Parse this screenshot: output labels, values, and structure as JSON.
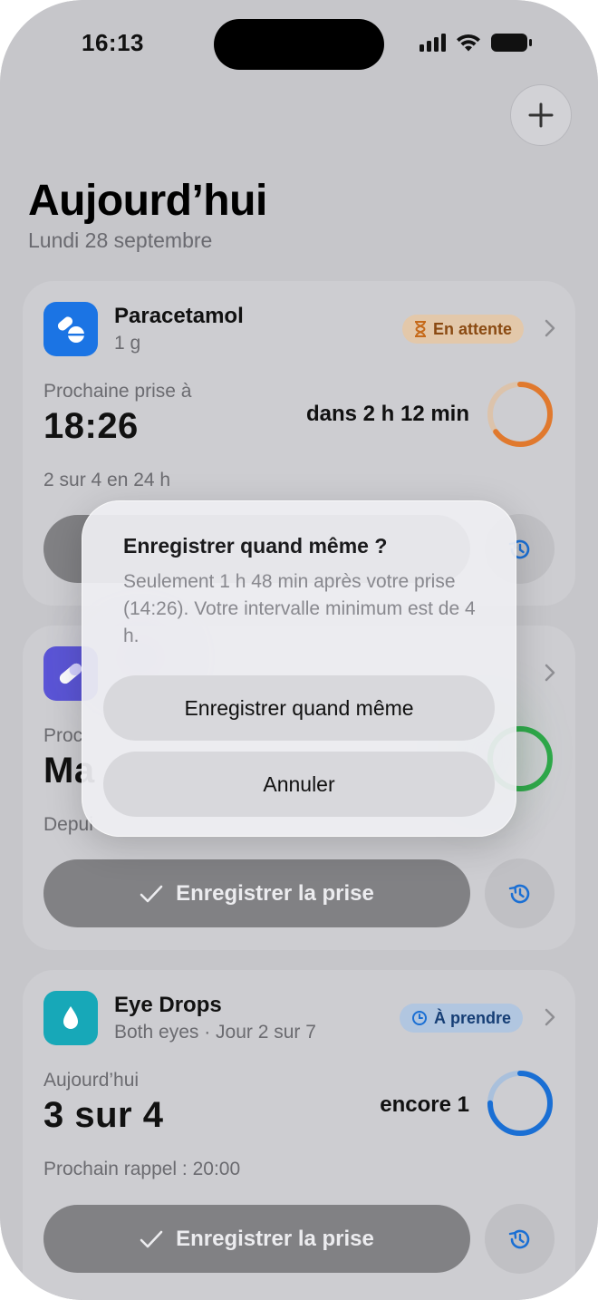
{
  "status_bar": {
    "time": "16:13"
  },
  "header": {
    "title": "Aujourd’hui",
    "date": "Lundi 28 septembre"
  },
  "cards": [
    {
      "name": "Paracetamol",
      "dose": "1 g",
      "status": "En attente",
      "label": "Prochaine prise à",
      "value": "18:26",
      "countdown": "dans 2 h 12 min",
      "footer": "2 sur 4 en 24 h",
      "ring_progress": 0.65,
      "accent": "#e0792e"
    },
    {
      "label_partial": "Proc",
      "value_partial": "Ma",
      "footer_partial": "Depui",
      "log_button": "Enregistrer la prise",
      "accent": "#2fa84a"
    },
    {
      "name": "Eye Drops",
      "dose": "Both eyes · Jour 2 sur 7",
      "status": "À prendre",
      "label": "Aujourd’hui",
      "value": "3 sur 4",
      "countdown": "encore 1",
      "footer": "Prochain rappel : 20:00",
      "log_button": "Enregistrer la prise",
      "ring_progress": 0.75,
      "accent": "#1a6fd4"
    }
  ],
  "dialog": {
    "title": "Enregistrer quand même ?",
    "message": "Seulement 1 h 48 min après votre prise (14:26). Votre intervalle minimum est de 4 h.",
    "confirm_label": "Enregistrer quand même",
    "cancel_label": "Annuler"
  },
  "colors": {
    "pending_badge_bg": "#e8cdb0",
    "pending_badge_text": "#8a4a12",
    "due_badge_bg": "#b4c9e3",
    "due_badge_text": "#163e75"
  }
}
